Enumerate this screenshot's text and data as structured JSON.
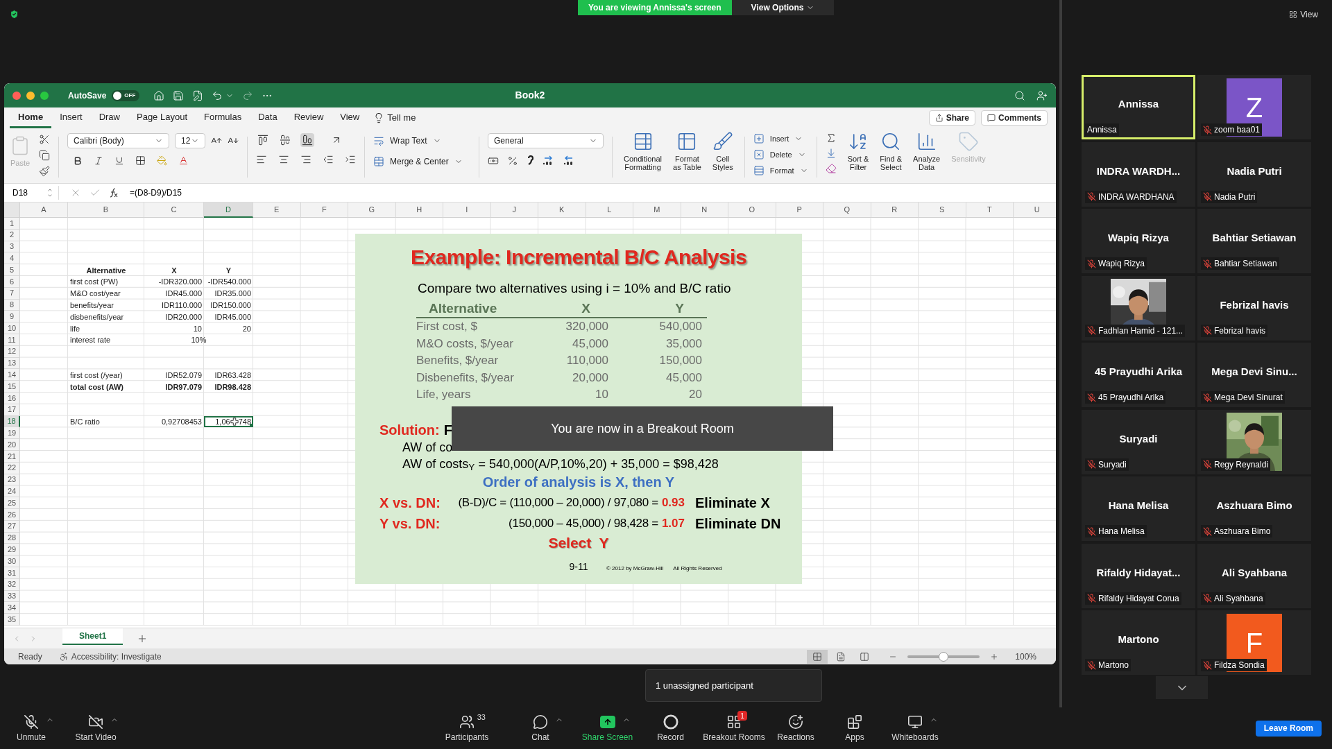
{
  "zoom_top": {
    "banner": "You are viewing Annissa's screen",
    "view_options": "View Options",
    "view": "View"
  },
  "excel": {
    "title": "Book2",
    "autosave": {
      "label": "AutoSave",
      "state": "OFF",
      "on": false
    },
    "tabs": [
      {
        "label": "Home",
        "selected": true
      },
      {
        "label": "Insert",
        "selected": false
      },
      {
        "label": "Draw",
        "selected": false
      },
      {
        "label": "Page Layout",
        "selected": false
      },
      {
        "label": "Formulas",
        "selected": false
      },
      {
        "label": "Data",
        "selected": false
      },
      {
        "label": "Review",
        "selected": false
      },
      {
        "label": "View",
        "selected": false
      }
    ],
    "tell_me": "Tell me",
    "share": "Share",
    "comments": "Comments",
    "ribbon": {
      "paste": {
        "label": "Paste",
        "disabled": true
      },
      "font": "Calibri (Body)",
      "size": "12",
      "vertical_align": [
        {
          "kind": "top",
          "selected": false
        },
        {
          "kind": "middle",
          "selected": false
        },
        {
          "kind": "bottom",
          "selected": true
        }
      ],
      "wrap": "Wrap Text",
      "merge": "Merge & Center",
      "number_format": "General",
      "big_buttons": [
        {
          "kind": "conditional",
          "label": "Conditional\nFormatting",
          "disabled": false
        },
        {
          "kind": "table",
          "label": "Format\nas Table",
          "disabled": false
        },
        {
          "kind": "styles",
          "label": "Cell\nStyles",
          "disabled": false
        }
      ],
      "cells": [
        {
          "kind": "insert",
          "label": "Insert"
        },
        {
          "kind": "delete",
          "label": "Delete"
        },
        {
          "kind": "format",
          "label": "Format"
        }
      ],
      "editing": [
        {
          "kind": "sort",
          "label": "Sort &\nFilter",
          "disabled": false
        },
        {
          "kind": "find",
          "label": "Find &\nSelect",
          "disabled": false
        },
        {
          "kind": "analyze",
          "label": "Analyze\nData",
          "disabled": false
        },
        {
          "kind": "sensitivity",
          "label": "Sensitivity",
          "disabled": true
        }
      ]
    },
    "name_box": "D18",
    "formula": "=(D8-D9)/D15",
    "columns": [
      {
        "label": "A",
        "selected": false
      },
      {
        "label": "B",
        "selected": false
      },
      {
        "label": "C",
        "selected": false
      },
      {
        "label": "D",
        "selected": true
      },
      {
        "label": "E",
        "selected": false
      },
      {
        "label": "F",
        "selected": false
      },
      {
        "label": "G",
        "selected": false
      },
      {
        "label": "H",
        "selected": false
      },
      {
        "label": "I",
        "selected": false
      },
      {
        "label": "J",
        "selected": false
      },
      {
        "label": "K",
        "selected": false
      },
      {
        "label": "L",
        "selected": false
      },
      {
        "label": "M",
        "selected": false
      },
      {
        "label": "N",
        "selected": false
      },
      {
        "label": "O",
        "selected": false
      },
      {
        "label": "P",
        "selected": false
      },
      {
        "label": "Q",
        "selected": false
      },
      {
        "label": "R",
        "selected": false
      },
      {
        "label": "S",
        "selected": false
      },
      {
        "label": "T",
        "selected": false
      },
      {
        "label": "U",
        "selected": false
      }
    ],
    "rows": [
      {
        "number": "1",
        "selected": false,
        "kind": "plain"
      },
      {
        "number": "2",
        "selected": false,
        "kind": "plain"
      },
      {
        "number": "3",
        "selected": false,
        "kind": "plain"
      },
      {
        "number": "4",
        "selected": false,
        "kind": "plain"
      },
      {
        "number": "5",
        "selected": false,
        "kind": "heading",
        "b": {
          "text": "Alternative",
          "selected": false
        },
        "c": {
          "text": "X",
          "selected": false
        },
        "d": {
          "text": "Y",
          "selected": false
        }
      },
      {
        "number": "6",
        "selected": false,
        "kind": "plain",
        "b": {
          "text": "first cost (PW)",
          "selected": false
        },
        "c": {
          "text": "-IDR320.000",
          "selected": false
        },
        "d": {
          "text": "-IDR540.000",
          "selected": false
        }
      },
      {
        "number": "7",
        "selected": false,
        "kind": "plain",
        "b": {
          "text": "M&O cost/year",
          "selected": false
        },
        "c": {
          "text": "IDR45.000",
          "selected": false
        },
        "d": {
          "text": "IDR35.000",
          "selected": false
        }
      },
      {
        "number": "8",
        "selected": false,
        "kind": "plain",
        "b": {
          "text": "benefits/year",
          "selected": false
        },
        "c": {
          "text": "IDR110.000",
          "selected": false
        },
        "d": {
          "text": "IDR150.000",
          "selected": false
        }
      },
      {
        "number": "9",
        "selected": false,
        "kind": "plain",
        "b": {
          "text": "disbenefits/year",
          "selected": false
        },
        "c": {
          "text": "IDR20.000",
          "selected": false
        },
        "d": {
          "text": "IDR45.000",
          "selected": false
        }
      },
      {
        "number": "10",
        "selected": false,
        "kind": "plain",
        "b": {
          "text": "life",
          "selected": false
        },
        "c": {
          "text": "10",
          "selected": false
        },
        "d": {
          "text": "20",
          "selected": false
        }
      },
      {
        "number": "11",
        "selected": false,
        "kind": "merged",
        "b": {
          "text": "interest rate",
          "selected": false
        },
        "c": {
          "text": "10%",
          "selected": false
        }
      },
      {
        "number": "12",
        "selected": false,
        "kind": "plain"
      },
      {
        "number": "13",
        "selected": false,
        "kind": "plain"
      },
      {
        "number": "14",
        "selected": false,
        "kind": "plain",
        "b": {
          "text": "first cost (/year)",
          "selected": false
        },
        "c": {
          "text": "IDR52.079",
          "selected": false
        },
        "d": {
          "text": "IDR63.428",
          "selected": false
        }
      },
      {
        "number": "15",
        "selected": false,
        "kind": "total",
        "b": {
          "text": "total cost (AW)",
          "selected": false
        },
        "c": {
          "text": "IDR97.079",
          "selected": false
        },
        "d": {
          "text": "IDR98.428",
          "selected": false
        }
      },
      {
        "number": "16",
        "selected": false,
        "kind": "plain"
      },
      {
        "number": "17",
        "selected": false,
        "kind": "plain"
      },
      {
        "number": "18",
        "selected": true,
        "kind": "plain",
        "b": {
          "text": "B/C ratio",
          "selected": false
        },
        "c": {
          "text": "0,92708453",
          "selected": false
        },
        "d": {
          "parts": [
            "1,06",
            "748"
          ],
          "selected": true
        }
      },
      {
        "number": "19",
        "selected": false,
        "kind": "plain"
      },
      {
        "number": "20",
        "selected": false,
        "kind": "plain"
      },
      {
        "number": "21",
        "selected": false,
        "kind": "plain"
      },
      {
        "number": "22",
        "selected": false,
        "kind": "plain"
      },
      {
        "number": "23",
        "selected": false,
        "kind": "plain"
      },
      {
        "number": "24",
        "selected": false,
        "kind": "plain"
      },
      {
        "number": "25",
        "selected": false,
        "kind": "plain"
      },
      {
        "number": "26",
        "selected": false,
        "kind": "plain"
      },
      {
        "number": "27",
        "selected": false,
        "kind": "plain"
      },
      {
        "number": "28",
        "selected": false,
        "kind": "plain"
      },
      {
        "number": "29",
        "selected": false,
        "kind": "plain"
      },
      {
        "number": "30",
        "selected": false,
        "kind": "plain"
      },
      {
        "number": "31",
        "selected": false,
        "kind": "plain"
      },
      {
        "number": "32",
        "selected": false,
        "kind": "plain"
      },
      {
        "number": "33",
        "selected": false,
        "kind": "plain"
      },
      {
        "number": "34",
        "selected": false,
        "kind": "plain"
      },
      {
        "number": "35",
        "selected": false,
        "kind": "plain"
      }
    ],
    "slide": {
      "title": "Example: Incremental B/C Analysis",
      "subtitle": "Compare two alternatives using i = 10% and B/C ratio",
      "columns": [
        "Alternative",
        "X",
        "Y"
      ],
      "rows": [
        [
          "First cost, $",
          "320,000",
          "540,000"
        ],
        [
          "M&O costs, $/year",
          "45,000",
          "35,000"
        ],
        [
          "Benefits, $/year",
          "110,000",
          "150,000"
        ],
        [
          "Disbenefits, $/year",
          "20,000",
          "45,000"
        ],
        [
          "Life, years",
          "10",
          "20"
        ]
      ],
      "solution_label": "Solution:",
      "solution_text": "F",
      "aw_x": "AW of co",
      "aw_y": "AW of costs$_{Y}$ = 540,000(A/P,10%,20) + 35,000 = $98,428",
      "order": "Order of analysis is X, then Y",
      "comparisons": [
        {
          "label": "X vs. DN:",
          "formula": "(B-D)/C = (110,000 – 20,000) / 97,080 =",
          "result": "0.93",
          "decision": "Eliminate X"
        },
        {
          "label": "Y vs. DN:",
          "formula": "(150,000 – 45,000) / 98,428 =",
          "result": "1.07",
          "decision": "Eliminate DN"
        }
      ],
      "select": "Select  Y",
      "page": "9-11",
      "copyright": "© 2012 by McGraw-Hill",
      "rights": "All Rights Reserved"
    },
    "sheet_tabs": [
      {
        "label": "Sheet1",
        "selected": true
      }
    ],
    "status": {
      "ready": "Ready",
      "accessibility": "Accessibility: Investigate",
      "views": [
        {
          "kind": "normal",
          "selected": true
        },
        {
          "kind": "layout",
          "selected": false
        },
        {
          "kind": "pagebreak",
          "selected": false
        }
      ],
      "zoom": {
        "level": 0.5,
        "reading": "100%"
      }
    }
  },
  "toast": "You are now in a Breakout Room",
  "participants": [
    {
      "kind": "name",
      "title": "Annissa",
      "name": "Annissa",
      "muted": false,
      "active": true
    },
    {
      "kind": "avatar",
      "letter": "Z",
      "color": "#7b55c7",
      "name": "zoom baa01",
      "muted": true,
      "active": false
    },
    {
      "kind": "name",
      "title": "INDRA  WARDH...",
      "name": "INDRA WARDHANA",
      "muted": true,
      "active": false
    },
    {
      "kind": "name",
      "title": "Nadia Putri",
      "name": "Nadia Putri",
      "muted": true,
      "active": false
    },
    {
      "kind": "name",
      "title": "Wapiq Rizya",
      "name": "Wapiq Rizya",
      "muted": true,
      "active": false
    },
    {
      "kind": "name",
      "title": "Bahtiar Setiawan",
      "name": "Bahtiar Setiawan",
      "muted": true,
      "active": false
    },
    {
      "name": "Fadhlan Hamid - 121...",
      "muted": true,
      "active": false
    },
    {
      "kind": "name",
      "title": "Febrizal havis",
      "name": "Febrizal havis",
      "muted": true,
      "active": false
    },
    {
      "kind": "name",
      "title": "45 Prayudhi Arika",
      "name": "45 Prayudhi Arika",
      "muted": true,
      "active": false
    },
    {
      "kind": "name",
      "title": "Mega  Devi  Sinu...",
      "name": "Mega Devi Sinurat",
      "muted": true,
      "active": false
    },
    {
      "kind": "name",
      "title": "Suryadi",
      "name": "Suryadi",
      "muted": true,
      "active": false
    },
    {
      "name": "Regy Reynaldi",
      "muted": true,
      "active": false
    },
    {
      "kind": "name",
      "title": "Hana Melisa",
      "name": "Hana Melisa",
      "muted": true,
      "active": false
    },
    {
      "kind": "name",
      "title": "Aszhuara Bimo",
      "name": "Aszhuara Bimo",
      "muted": true,
      "active": false
    },
    {
      "kind": "name",
      "title": "Rifaldy  Hidayat...",
      "name": "Rifaldy Hidayat Corua",
      "muted": true,
      "active": false
    },
    {
      "kind": "name",
      "title": "Ali Syahbana",
      "name": "Ali Syahbana",
      "muted": true,
      "active": false
    },
    {
      "kind": "name",
      "title": "Martono",
      "name": "Martono",
      "muted": true,
      "active": false
    },
    {
      "kind": "avatar",
      "letter": "F",
      "color": "#f25a1e",
      "name": "Fildza Sondia",
      "muted": true,
      "active": false
    }
  ],
  "toolbar": {
    "left": [
      {
        "kind": "mic",
        "label": "Unmute",
        "caret": true
      },
      {
        "kind": "video",
        "label": "Start Video",
        "caret": true
      }
    ],
    "center": [
      {
        "kind": "participants",
        "label": "Participants",
        "count": "33",
        "caret": false
      },
      {
        "kind": "chat",
        "label": "Chat",
        "caret": true
      },
      {
        "kind": "share",
        "label": "Share Screen",
        "caret": true
      },
      {
        "kind": "record",
        "label": "Record",
        "caret": false
      },
      {
        "kind": "breakout",
        "label": "Breakout Rooms",
        "badge": "1",
        "caret": false
      },
      {
        "kind": "reactions",
        "label": "Reactions",
        "caret": false
      },
      {
        "kind": "apps",
        "label": "Apps",
        "caret": false
      },
      {
        "kind": "whiteboards",
        "label": "Whiteboards",
        "caret": true
      }
    ],
    "leave": "Leave Room"
  },
  "tooltip": "1 unassigned participant"
}
